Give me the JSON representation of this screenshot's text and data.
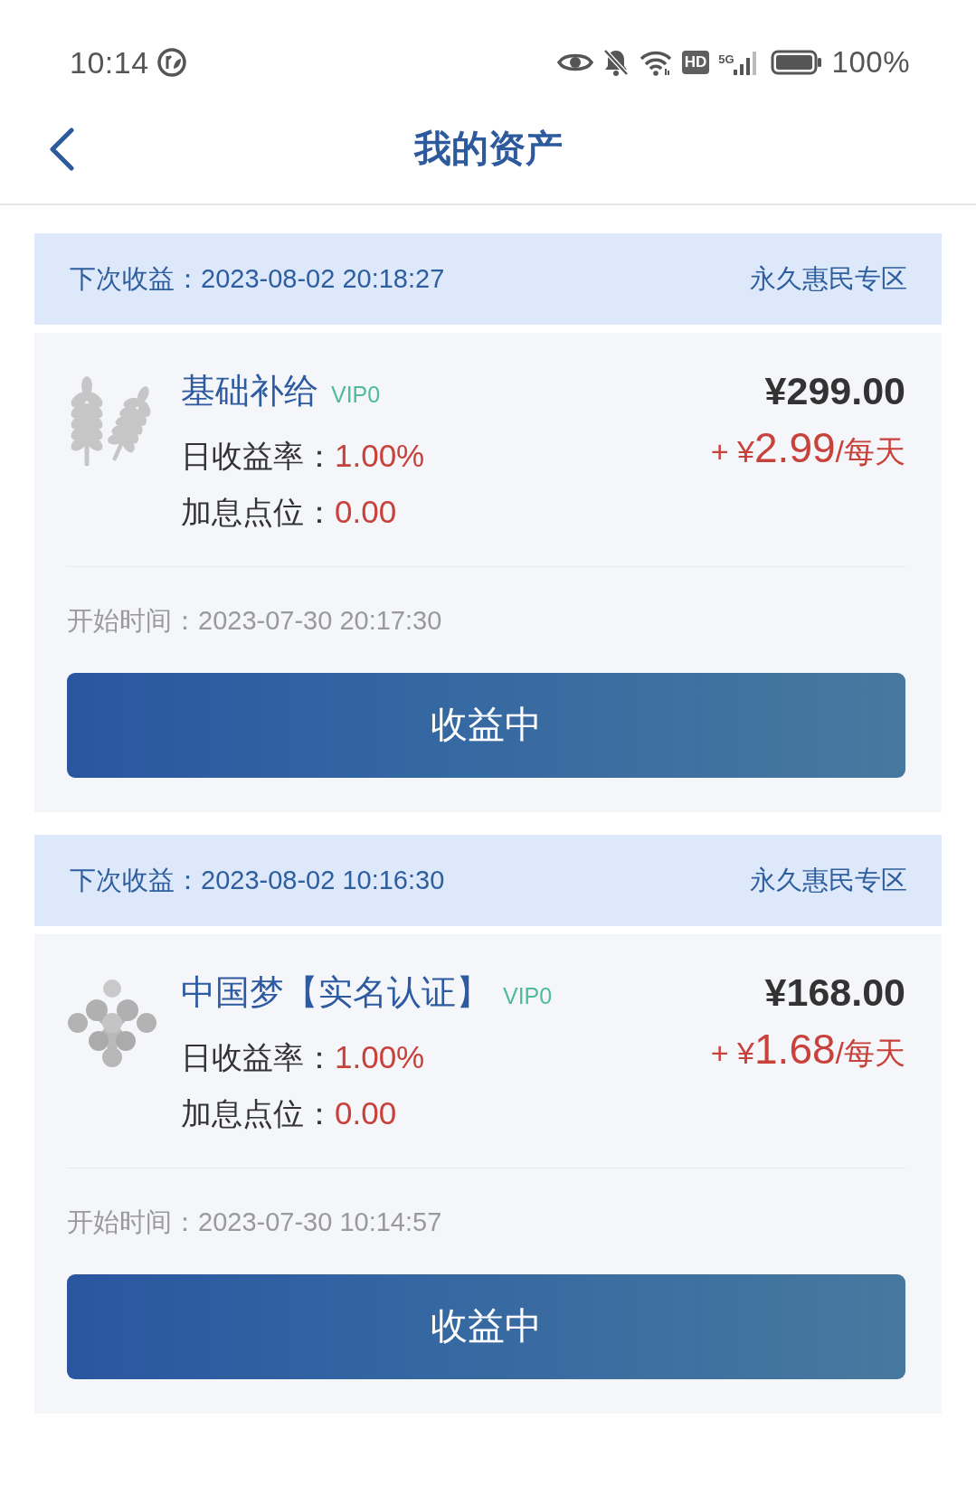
{
  "status_bar": {
    "time": "10:14",
    "hd": "HD",
    "network": "5G",
    "battery": "100%"
  },
  "header": {
    "title": "我的资产"
  },
  "assets": [
    {
      "next_payout": "下次收益：2023-08-02 20:18:27",
      "zone": "永久惠民专区",
      "kind": "wheat",
      "name": "基础补给",
      "vip": "VIP0",
      "rate_label": "日收益率：",
      "rate": "1.00%",
      "bonus_label": "加息点位：",
      "bonus": "0.00",
      "price": "¥299.00",
      "daily_prefix": "+ ¥",
      "daily_amount": "2.99",
      "daily_suffix": "/每天",
      "start_time": "开始时间：2023-07-30 20:17:30",
      "button": "收益中"
    },
    {
      "next_payout": "下次收益：2023-08-02 10:16:30",
      "zone": "永久惠民专区",
      "kind": "network",
      "name": "中国梦【实名认证】",
      "vip": "VIP0",
      "rate_label": "日收益率：",
      "rate": "1.00%",
      "bonus_label": "加息点位：",
      "bonus": "0.00",
      "price": "¥168.00",
      "daily_prefix": "+ ¥",
      "daily_amount": "1.68",
      "daily_suffix": "/每天",
      "start_time": "开始时间：2023-07-30 10:14:57",
      "button": "收益中"
    }
  ]
}
